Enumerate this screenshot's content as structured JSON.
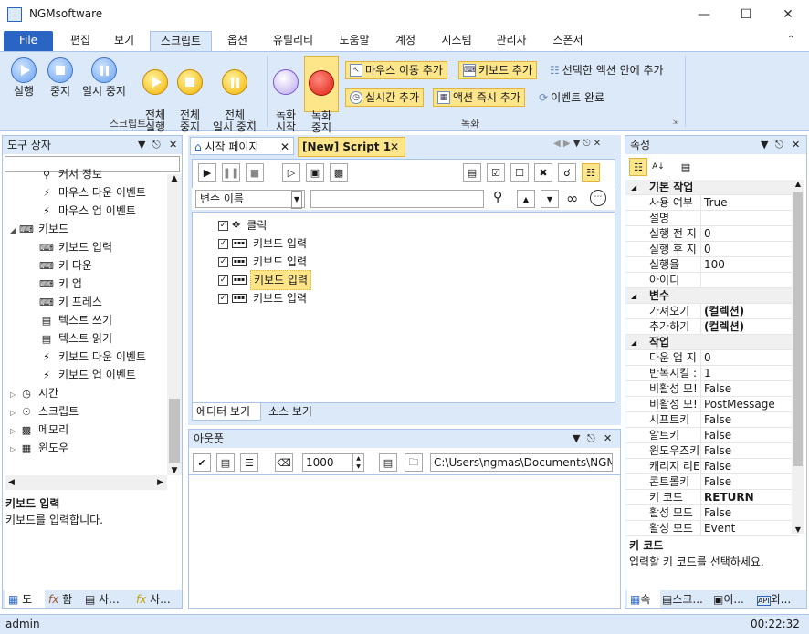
{
  "window": {
    "title": "NGMsoftware"
  },
  "ribbon_tabs": [
    "File",
    "편집",
    "보기",
    "스크립트",
    "옵션",
    "유틸리티",
    "도움말",
    "계정",
    "시스템",
    "관리자",
    "스폰서"
  ],
  "ribbon": {
    "script_group": {
      "label": "스크립트",
      "run": "실행",
      "stop": "중지",
      "pause": "일시 중지",
      "run_all": "전체\n실행",
      "stop_all": "전체\n중지",
      "pause_all": "전체\n일시 중지"
    },
    "record_group": {
      "label": "녹화",
      "record_start": "녹화\n시작",
      "record_stop": "녹화\n중지",
      "add_mouse_move": "마우스 이동 추가",
      "add_keyboard": "키보드 추가",
      "add_in_selected": "선택한 액션 안에 추가",
      "add_realtime": "실시간 추가",
      "add_action_now": "액션 즉시 추가",
      "event_complete": "이벤트 완료"
    }
  },
  "toolbox": {
    "title": "도구 상자",
    "items": [
      {
        "icon": "cursor-info-icon",
        "label": "커서 정보",
        "indent": 2
      },
      {
        "icon": "lightning-icon",
        "label": "마우스 다운 이벤트",
        "indent": 2
      },
      {
        "icon": "lightning-icon",
        "label": "마우스 업 이벤트",
        "indent": 2
      },
      {
        "icon": "keyboard-icon",
        "label": "키보드",
        "indent": 1,
        "expander": "◢"
      },
      {
        "icon": "keyboard-icon",
        "label": "키보드 입력",
        "indent": 2
      },
      {
        "icon": "keyboard-icon",
        "label": "키 다운",
        "indent": 2
      },
      {
        "icon": "keyboard-icon",
        "label": "키 업",
        "indent": 2
      },
      {
        "icon": "keyboard-icon",
        "label": "키 프레스",
        "indent": 2
      },
      {
        "icon": "book-icon",
        "label": "텍스트 쓰기",
        "indent": 2
      },
      {
        "icon": "book-icon",
        "label": "텍스트 읽기",
        "indent": 2
      },
      {
        "icon": "lightning-icon",
        "label": "키보드 다운 이벤트",
        "indent": 2
      },
      {
        "icon": "lightning-icon",
        "label": "키보드 업 이벤트",
        "indent": 2
      },
      {
        "icon": "clock-icon",
        "label": "시간",
        "indent": 1,
        "expander": "▷"
      },
      {
        "icon": "script-icon",
        "label": "스크립트",
        "indent": 1,
        "expander": "▷"
      },
      {
        "icon": "memory-icon",
        "label": "메모리",
        "indent": 1,
        "expander": "▷"
      },
      {
        "icon": "windows-icon",
        "label": "윈도우",
        "indent": 1,
        "expander": "▷"
      }
    ],
    "desc_title": "키보드 입력",
    "desc_text": "키보드를 입력합니다.",
    "bottom_tabs": [
      "도",
      "함",
      "사...",
      "사..."
    ]
  },
  "editor": {
    "tabs": [
      "시작 페이지",
      "[New] Script 1"
    ],
    "variable_placeholder": "변수 이름",
    "lines": [
      {
        "icon": "mouse-icon",
        "label": "클릭"
      },
      {
        "icon": "keyboard-icon",
        "label": "키보드 입력"
      },
      {
        "icon": "keyboard-icon",
        "label": "키보드 입력"
      },
      {
        "icon": "keyboard-icon",
        "label": "키보드 입력",
        "selected": true
      },
      {
        "icon": "keyboard-icon",
        "label": "키보드 입력"
      }
    ],
    "view_tabs": [
      "에디터 보기",
      "소스 보기"
    ]
  },
  "output": {
    "title": "아웃풋",
    "interval": "1000",
    "path": "C:\\Users\\ngmas\\Documents\\NGM6\\"
  },
  "props": {
    "title": "속성",
    "rows": [
      {
        "cat": true,
        "k": "기본 작업"
      },
      {
        "k": "사용 여부",
        "v": "True"
      },
      {
        "k": "설명",
        "v": ""
      },
      {
        "k": "실행 전 지",
        "v": "0"
      },
      {
        "k": "실행 후 지",
        "v": "0"
      },
      {
        "k": "실행율",
        "v": "100"
      },
      {
        "k": "아이디",
        "v": ""
      },
      {
        "cat": true,
        "k": "변수"
      },
      {
        "k": "가져오기",
        "v": "(컬렉션)",
        "bold": true
      },
      {
        "k": "추가하기",
        "v": "(컬렉션)",
        "bold": true
      },
      {
        "cat": true,
        "k": "작업"
      },
      {
        "k": "다운 업 지",
        "v": "0"
      },
      {
        "k": "반복시킬 :",
        "v": "1"
      },
      {
        "k": "비활성 모!",
        "v": "False"
      },
      {
        "k": "비활성 모!",
        "v": "PostMessage"
      },
      {
        "k": "시프트키",
        "v": "False"
      },
      {
        "k": "알트키",
        "v": "False"
      },
      {
        "k": "윈도우즈키",
        "v": "False"
      },
      {
        "k": "캐리지 리E",
        "v": "False"
      },
      {
        "k": "콘트롤키",
        "v": "False"
      },
      {
        "k": "키 코드",
        "v": "RETURN",
        "bold": true
      },
      {
        "k": "활성 모드",
        "v": "False"
      },
      {
        "k": "활성 모드",
        "v": "Event"
      }
    ],
    "desc_title": "키 코드",
    "desc_text": "입력할 키 코드를 선택하세요.",
    "bottom_tabs": [
      "속",
      "스크...",
      "이...",
      "외..."
    ]
  },
  "status": {
    "user": "admin",
    "time": "00:22:32"
  }
}
